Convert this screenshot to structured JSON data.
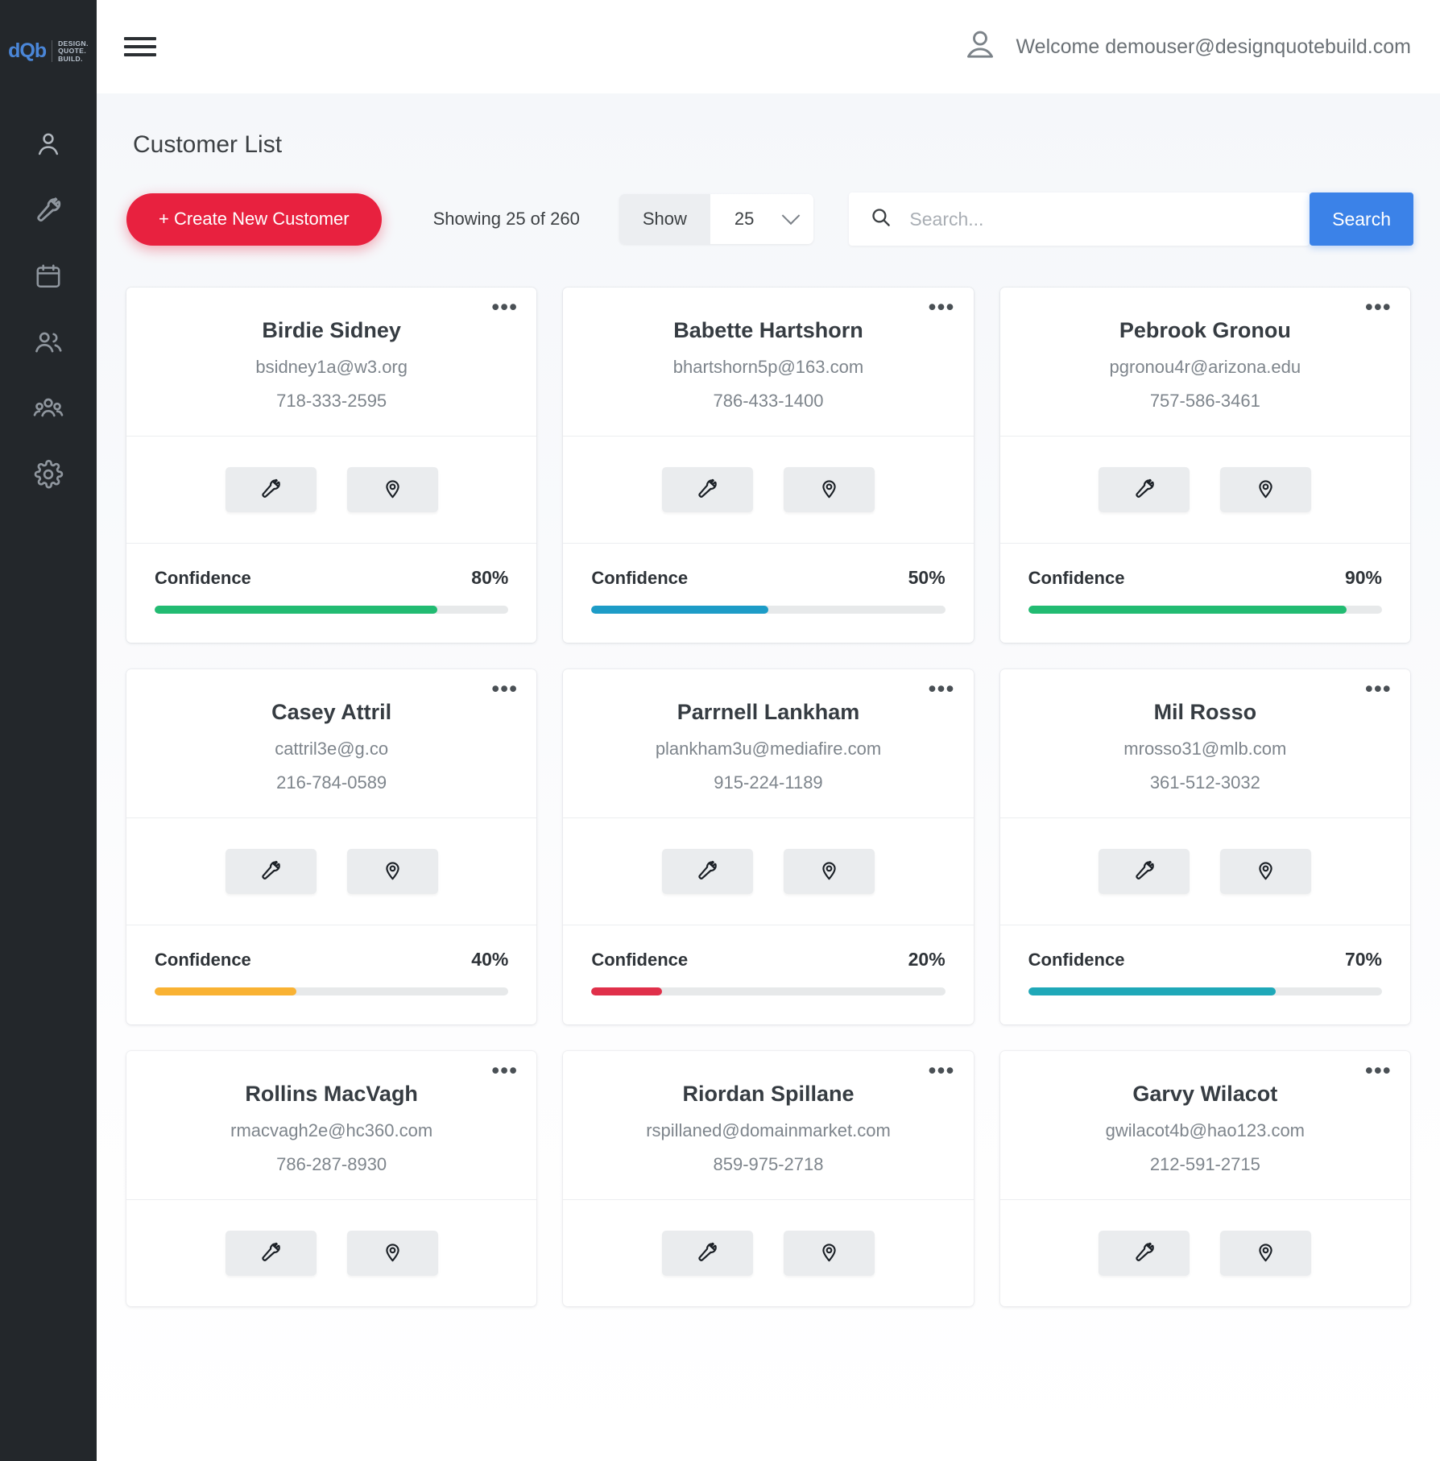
{
  "sidebar": {
    "logo": {
      "mark": "dQb",
      "line1": "DESIGN.",
      "line2": "QUOTE.",
      "line3": "BUILD."
    },
    "items": [
      {
        "icon": "person-icon",
        "name": "sidebar-item-customers"
      },
      {
        "icon": "hammer-icon",
        "name": "sidebar-item-jobs"
      },
      {
        "icon": "calendar-icon",
        "name": "sidebar-item-schedule"
      },
      {
        "icon": "people-icon",
        "name": "sidebar-item-contacts"
      },
      {
        "icon": "group-icon",
        "name": "sidebar-item-teams"
      },
      {
        "icon": "gear-icon",
        "name": "sidebar-item-settings"
      }
    ]
  },
  "topbar": {
    "menu_icon": "hamburger-icon",
    "avatar_icon": "user-avatar-icon",
    "welcome": "Welcome demouser@designquotebuild.com"
  },
  "page": {
    "title": "Customer List"
  },
  "toolbar": {
    "create_label": "+ Create New Customer",
    "showing_text": "Showing 25 of 260",
    "show_label": "Show",
    "show_value": "25",
    "show_options": [
      "25"
    ],
    "search_placeholder": "Search...",
    "search_value": "",
    "search_button": "Search",
    "search_icon": "search-icon",
    "chevron_icon": "chevron-down-icon"
  },
  "colors": {
    "brand_red": "#e8213f",
    "brand_blue": "#3b82e8",
    "sidebar": "#23272b",
    "green": "#22bb72",
    "blue": "#1d9cc7",
    "teal": "#1fa8b8",
    "amber": "#f9b233",
    "crimson": "#e0304a"
  },
  "card_common": {
    "menu_icon": "more-options-icon",
    "action_hammer_icon": "hammer-icon",
    "action_location_icon": "map-pin-icon",
    "confidence_label": "Confidence"
  },
  "customers": [
    {
      "name": "Birdie Sidney",
      "email": "bsidney1a@w3.org",
      "phone": "718-333-2595",
      "confidence": "80%",
      "confidence_pct": 80,
      "confidence_color": "#22bb72"
    },
    {
      "name": "Babette Hartshorn",
      "email": "bhartshorn5p@163.com",
      "phone": "786-433-1400",
      "confidence": "50%",
      "confidence_pct": 50,
      "confidence_color": "#1d9cc7"
    },
    {
      "name": "Pebrook Gronou",
      "email": "pgronou4r@arizona.edu",
      "phone": "757-586-3461",
      "confidence": "90%",
      "confidence_pct": 90,
      "confidence_color": "#22bb72"
    },
    {
      "name": "Casey Attril",
      "email": "cattril3e@g.co",
      "phone": "216-784-0589",
      "confidence": "40%",
      "confidence_pct": 40,
      "confidence_color": "#f9b233"
    },
    {
      "name": "Parrnell Lankham",
      "email": "plankham3u@mediafire.com",
      "phone": "915-224-1189",
      "confidence": "20%",
      "confidence_pct": 20,
      "confidence_color": "#e0304a"
    },
    {
      "name": "Mil Rosso",
      "email": "mrosso31@mlb.com",
      "phone": "361-512-3032",
      "confidence": "70%",
      "confidence_pct": 70,
      "confidence_color": "#1fa8b8"
    },
    {
      "name": "Rollins MacVagh",
      "email": "rmacvagh2e@hc360.com",
      "phone": "786-287-8930",
      "confidence": "",
      "confidence_pct": 0,
      "confidence_color": "#22bb72"
    },
    {
      "name": "Riordan Spillane",
      "email": "rspillaned@domainmarket.com",
      "phone": "859-975-2718",
      "confidence": "",
      "confidence_pct": 0,
      "confidence_color": "#22bb72"
    },
    {
      "name": "Garvy Wilacot",
      "email": "gwilacot4b@hao123.com",
      "phone": "212-591-2715",
      "confidence": "",
      "confidence_pct": 0,
      "confidence_color": "#22bb72"
    }
  ]
}
